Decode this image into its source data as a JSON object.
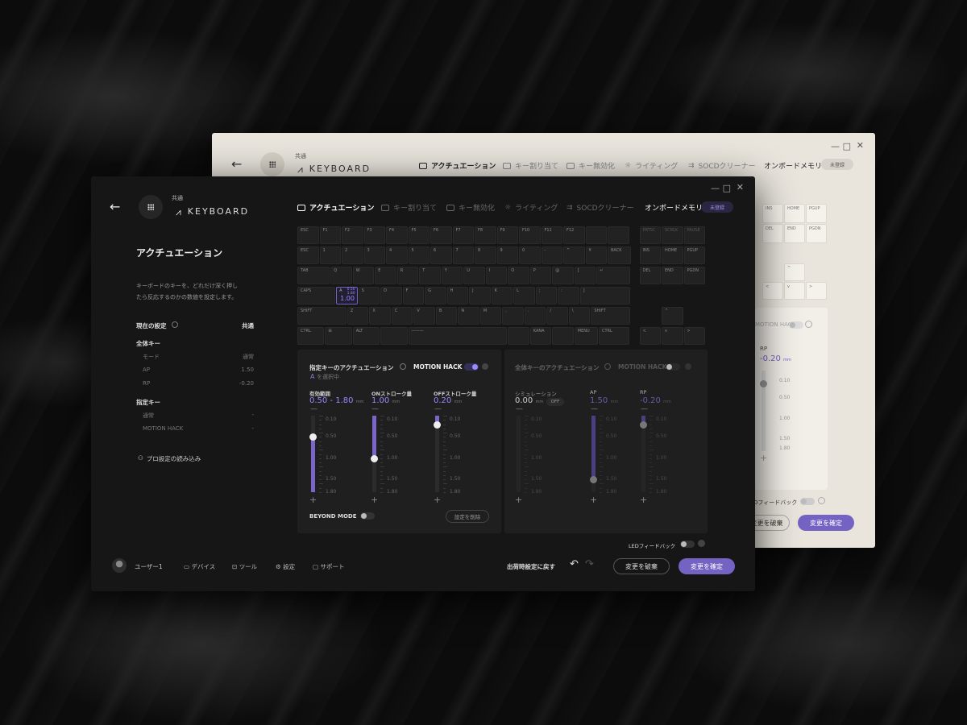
{
  "light_window": {
    "back_label": "←",
    "brand_small": "共通",
    "brand": "KEYBOARD",
    "tabs": [
      "アクチュエーション",
      "キー割り当て",
      "キー無効化",
      "ライティング",
      "SOCDクリーナー"
    ],
    "onboard": "オンボードメモリ",
    "badge": "未登録",
    "nav_keys": [
      "INS",
      "HOME",
      "PGUP",
      "DEL",
      "END",
      "PGDN"
    ],
    "motion_hack": "MOTION HACK",
    "rp_label": "RP",
    "rp_value": "-0.20",
    "rp_unit": "mm",
    "ticks": [
      "0.10",
      "0.50",
      "1.00",
      "1.50",
      "1.80"
    ],
    "led_label": "Dフィードバック",
    "discard": "変更を破棄",
    "confirm": "変更を確定"
  },
  "dark_window": {
    "brand_small": "共通",
    "brand": "KEYBOARD",
    "tabs": [
      "アクチュエーション",
      "キー割り当て",
      "キー無効化",
      "ライティング",
      "SOCDクリーナー"
    ],
    "onboard": "オンボードメモリ",
    "badge": "未登録",
    "sidebar": {
      "title": "アクチュエーション",
      "desc1": "キーボードのキーを、どれだけ深く押し",
      "desc2": "たら反応するのかの数値を設定します。",
      "current": "現在の設定",
      "current_value": "共通",
      "all_keys": "全体キー",
      "rows": [
        {
          "k": "モード",
          "v": "通常"
        },
        {
          "k": "AP",
          "v": "1.50"
        },
        {
          "k": "RP",
          "v": "-0.20"
        }
      ],
      "specified": "指定キー",
      "spec_rows": [
        {
          "k": "通常",
          "v": "-"
        },
        {
          "k": "MOTION HACK",
          "v": "-"
        }
      ],
      "pro_load": "プロ設定の読み込み"
    },
    "keyboard": {
      "row1": [
        "ESC",
        "F1",
        "F2",
        "F3",
        "F4",
        "F5",
        "F6",
        "F7",
        "F8",
        "F9",
        "F10",
        "F11",
        "F12",
        "",
        ""
      ],
      "row2": [
        "ESC",
        "1",
        "2",
        "3",
        "4",
        "5",
        "6",
        "7",
        "8",
        "9",
        "0",
        "-",
        "^",
        "¥",
        "BACK"
      ],
      "row3": [
        "TAB",
        "Q",
        "W",
        "E",
        "R",
        "T",
        "Y",
        "U",
        "I",
        "O",
        "P",
        "@",
        "[",
        "↵"
      ],
      "row4": [
        "CAPS",
        "",
        "S",
        "D",
        "F",
        "G",
        "H",
        "J",
        "K",
        "L",
        ";",
        ":",
        "]"
      ],
      "row5": [
        "SHIFT",
        "Z",
        "X",
        "C",
        "V",
        "B",
        "N",
        "M",
        ",",
        ".",
        "/",
        "\\",
        "SHIFT"
      ],
      "row6": [
        "CTRL",
        "⊞",
        "ALT",
        "",
        "———",
        "",
        "KANA",
        "",
        "MENU",
        "CTRL"
      ],
      "nav": [
        "INS",
        "HOME",
        "PGUP",
        "DEL",
        "END",
        "PGDN"
      ],
      "nav_top": [
        "PRTSC",
        "SCRLK",
        "PAUSE"
      ],
      "arrows": [
        "^",
        "<",
        "v",
        ">"
      ],
      "selected_key": {
        "label": "A",
        "v1": "0.50",
        "v2": "1.80",
        "main": "1.00"
      }
    },
    "left_panel": {
      "title": "指定キーのアクチュエーション",
      "motion_hack": "MOTION HACK",
      "selected_letter": "A",
      "selected_suffix": "を選択中",
      "range_label": "有効範囲",
      "range_value": "0.50 - 1.80",
      "on_label": "ONストローク量",
      "on_value": "1.00",
      "off_label": "OFFストローク量",
      "off_value": "0.20",
      "unit": "mm",
      "ticks": [
        "0.10",
        "0.50",
        "1.00",
        "1.50",
        "1.80"
      ],
      "beyond": "BEYOND MODE",
      "reset": "設定を削除",
      "range_fill": [
        0.5,
        1.8
      ],
      "on_fill": 1.0,
      "off_fill": 0.2
    },
    "right_panel": {
      "title": "全体キーのアクチュエーション",
      "motion_hack": "MOTION HACK",
      "sim_label": "シミュレーション",
      "sim_value": "0.00",
      "sim_off": "OFF",
      "ap_label": "AP",
      "ap_value": "1.50",
      "rp_label": "RP",
      "rp_value": "-0.20",
      "unit": "mm",
      "ticks": [
        "0.10",
        "0.50",
        "1.00",
        "1.50",
        "1.80"
      ],
      "ap_fill": 1.5,
      "rp_fill": 0.2
    },
    "led": "LEDフィードバック",
    "footer": {
      "user": "ユーザー1",
      "device": "デバイス",
      "tool": "ツール",
      "settings": "設定",
      "support": "サポート",
      "factory": "出荷時設定に戻す",
      "discard": "変更を破棄",
      "confirm": "変更を確定"
    }
  },
  "colors": {
    "accent": "#7563c4",
    "accent_light": "#8f7ad8",
    "dark_bg": "#161616",
    "light_bg": "#e9e5dd"
  }
}
